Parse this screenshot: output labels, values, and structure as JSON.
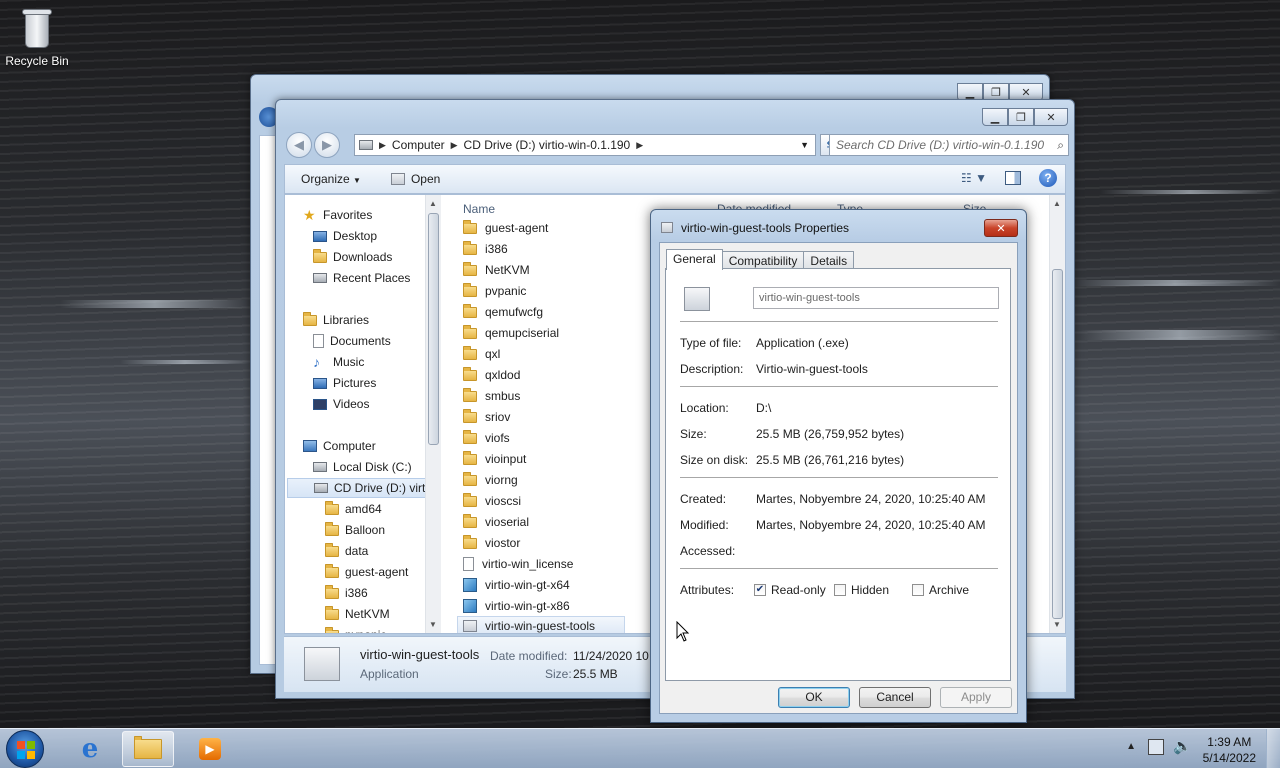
{
  "desktop": {
    "recycle_bin_label": "Recycle Bin"
  },
  "explorer": {
    "breadcrumb": [
      "Computer",
      "CD Drive (D:) virtio-win-0.1.190"
    ],
    "search_placeholder": "Search CD Drive (D:) virtio-win-0.1.190",
    "toolbar": {
      "organize": "Organize",
      "open": "Open"
    },
    "columns": {
      "name": "Name",
      "date_modified": "Date modified",
      "type": "Type",
      "size": "Size"
    },
    "nav": {
      "favorites": "Favorites",
      "desktop": "Desktop",
      "downloads": "Downloads",
      "recent_places": "Recent Places",
      "libraries": "Libraries",
      "documents": "Documents",
      "music": "Music",
      "pictures": "Pictures",
      "videos": "Videos",
      "computer": "Computer",
      "local_disk": "Local Disk (C:)",
      "cd_drive": "CD Drive (D:) virt",
      "sub": [
        "amd64",
        "Balloon",
        "data",
        "guest-agent",
        "i386",
        "NetKVM",
        "pvpanic"
      ]
    },
    "files": [
      "guest-agent",
      "i386",
      "NetKVM",
      "pvpanic",
      "qemufwcfg",
      "qemupciserial",
      "qxl",
      "qxldod",
      "smbus",
      "sriov",
      "viofs",
      "vioinput",
      "viorng",
      "vioscsi",
      "vioserial",
      "viostor",
      "virtio-win_license",
      "virtio-win-gt-x64",
      "virtio-win-gt-x86",
      "virtio-win-guest-tools"
    ],
    "details": {
      "name": "virtio-win-guest-tools",
      "type": "Application",
      "date_label": "Date modified:",
      "date_value": "11/24/2020 10:",
      "size_label": "Size:",
      "size_value": "25.5 MB"
    }
  },
  "dialog": {
    "title": "virtio-win-guest-tools Properties",
    "tabs": [
      "General",
      "Compatibility",
      "Details"
    ],
    "name_value": "virtio-win-guest-tools",
    "labels": {
      "type": "Type of file:",
      "description": "Description:",
      "location": "Location:",
      "size": "Size:",
      "size_on_disk": "Size on disk:",
      "created": "Created:",
      "modified": "Modified:",
      "accessed": "Accessed:",
      "attributes": "Attributes:"
    },
    "values": {
      "type": "Application (.exe)",
      "description": "Virtio-win-guest-tools",
      "location": "D:\\",
      "size": "25.5 MB (26,759,952 bytes)",
      "size_on_disk": "25.5 MB (26,761,216 bytes)",
      "created": "Martes, Nobyembre 24, 2020, 10:25:40 AM",
      "modified": "Martes, Nobyembre 24, 2020, 10:25:40 AM",
      "accessed": ""
    },
    "attributes": {
      "readonly_label": "Read-only",
      "readonly_checked": true,
      "hidden_label": "Hidden",
      "hidden_checked": false,
      "archive_label": "Archive",
      "archive_checked": false
    },
    "buttons": {
      "ok": "OK",
      "cancel": "Cancel",
      "apply": "Apply"
    }
  },
  "taskbar": {
    "time": "1:39 AM",
    "date": "5/14/2022"
  }
}
